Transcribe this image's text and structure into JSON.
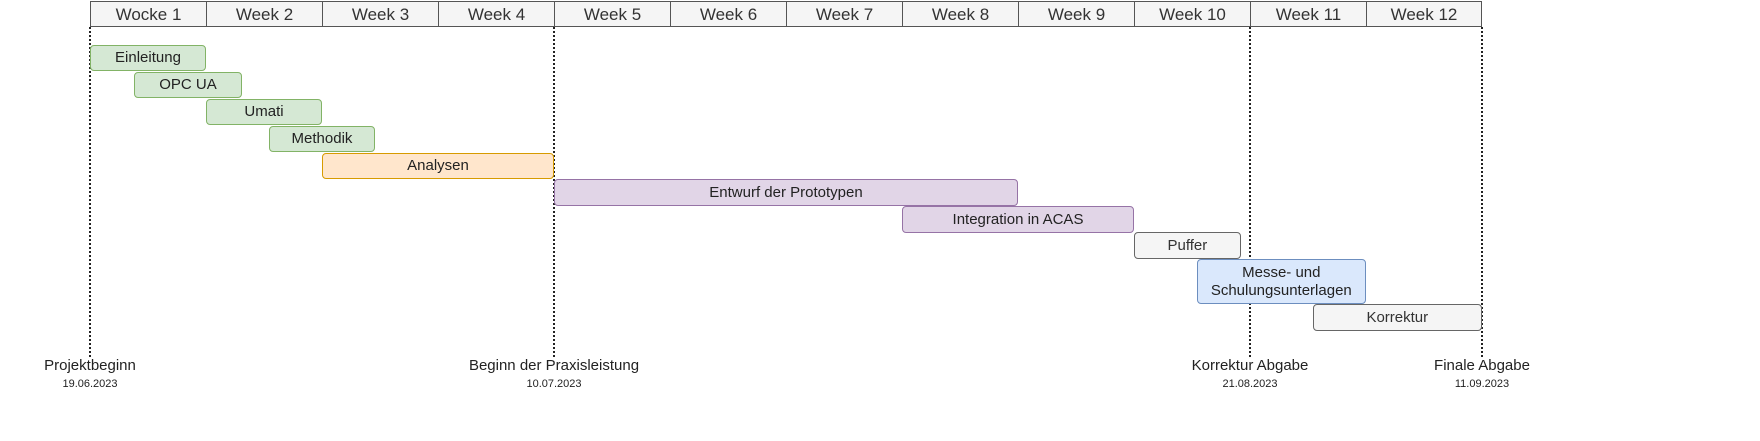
{
  "weeks": [
    "Wocke 1",
    "Week 2",
    "Week 3",
    "Week 4",
    "Week 5",
    "Week 6",
    "Week 7",
    "Week 8",
    "Week 9",
    "Week 10",
    "Week 11",
    "Week 12"
  ],
  "tasks": [
    {
      "label": "Einleitung",
      "start": 1,
      "end": 2,
      "color": "green"
    },
    {
      "label": "OPC UA",
      "start": 1.38,
      "end": 2.31,
      "color": "green"
    },
    {
      "label": "Umati",
      "start": 2,
      "end": 3,
      "color": "green"
    },
    {
      "label": "Methodik",
      "start": 2.54,
      "end": 3.46,
      "color": "green"
    },
    {
      "label": "Analysen",
      "start": 3,
      "end": 5,
      "color": "orange"
    },
    {
      "label": "Entwurf der Prototypen",
      "start": 5,
      "end": 9,
      "color": "purple"
    },
    {
      "label": "Integration in ACAS",
      "start": 8,
      "end": 10,
      "color": "purple"
    },
    {
      "label": "Puffer",
      "start": 10,
      "end": 10.92,
      "color": "grey"
    },
    {
      "label": "Messe- und Schulungsunterlagen",
      "start": 10.54,
      "end": 12,
      "color": "blue"
    },
    {
      "label": "Korrektur",
      "start": 11.54,
      "end": 13,
      "color": "grey"
    }
  ],
  "milestones": [
    {
      "label": "Projektbeginn",
      "date": "19.06.2023",
      "week": 1
    },
    {
      "label": "Beginn der Praxisleistung",
      "date": "10.07.2023",
      "week": 5
    },
    {
      "label": "Korrektur Abgabe",
      "date": "21.08.2023",
      "week": 11
    },
    {
      "label": "Finale Abgabe",
      "date": "11.09.2023",
      "week": 13
    }
  ]
}
